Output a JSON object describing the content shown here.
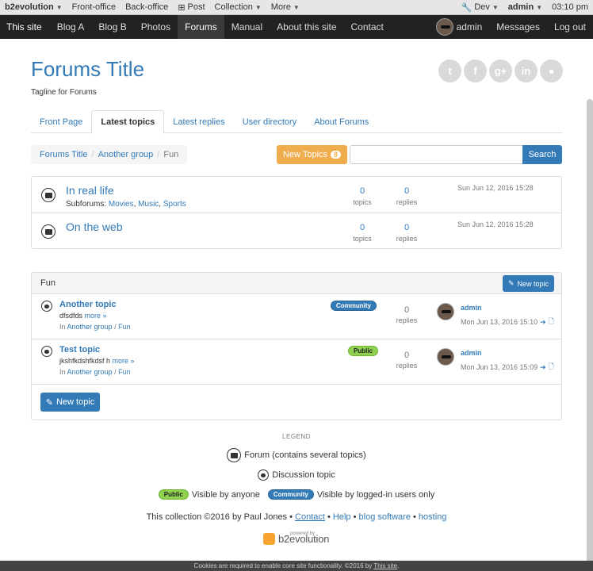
{
  "adminbar": {
    "left_items": [
      {
        "label": "b2evolution",
        "caret": true,
        "bold": true
      },
      {
        "label": "Front-office",
        "caret": false,
        "bold": false
      },
      {
        "label": "Back-office",
        "caret": false,
        "bold": false
      },
      {
        "label": "Post",
        "caret": false,
        "bold": false
      },
      {
        "label": "Collection",
        "caret": true,
        "bold": false
      },
      {
        "label": "More",
        "caret": true,
        "bold": false
      }
    ],
    "dev_label": "Dev",
    "user_label": "admin",
    "time": "03:10 pm"
  },
  "navbar": {
    "brand": "This site",
    "items": [
      "Blog A",
      "Blog B",
      "Photos",
      "Forums",
      "Manual",
      "About this site",
      "Contact"
    ],
    "active": "Forums",
    "user": "admin",
    "messages": "Messages",
    "logout": "Log out"
  },
  "page": {
    "title": "Forums Title",
    "tagline": "Tagline for Forums",
    "social_icons": [
      "twitter-icon",
      "facebook-icon",
      "googleplus-icon",
      "linkedin-icon",
      "github-icon"
    ]
  },
  "tabs": [
    "Front Page",
    "Latest topics",
    "Latest replies",
    "User directory",
    "About Forums"
  ],
  "active_tab": "Latest topics",
  "breadcrumb": {
    "items": [
      "Forums Title",
      "Another group"
    ],
    "current": "Fun"
  },
  "toolbar": {
    "new_topics_label": "New Topics",
    "new_topics_count": "8",
    "search_placeholder": "",
    "search_label": "Search"
  },
  "forums": [
    {
      "name": "In real life",
      "subforums_label": "Subforums:",
      "subforums": [
        "Movies",
        "Music",
        "Sports"
      ],
      "topics": "0",
      "topics_label": "topics",
      "replies": "0",
      "replies_label": "replies",
      "date": "Sun Jun 12, 2016 15:28"
    },
    {
      "name": "On the web",
      "subforums_label": "",
      "subforums": [],
      "topics": "0",
      "topics_label": "topics",
      "replies": "0",
      "replies_label": "replies",
      "date": "Sun Jun 12, 2016 15:28"
    }
  ],
  "topics_panel": {
    "title": "Fun",
    "new_topic_label": "New topic",
    "topics": [
      {
        "title": "Another topic",
        "excerpt": "dfsdfds",
        "more": "more »",
        "in_label": "In",
        "group": "Another group",
        "forum": "Fun",
        "badge": "Community",
        "badge_type": "comm",
        "replies": "0",
        "replies_label": "replies",
        "user": "admin",
        "date": "Mon Jun 13, 2016 15:10"
      },
      {
        "title": "Test topic",
        "excerpt": "jkshfkdshfkdsf h",
        "more": "more »",
        "in_label": "In",
        "group": "Another group",
        "forum": "Fun",
        "badge": "Public",
        "badge_type": "pub",
        "replies": "0",
        "replies_label": "replies",
        "user": "admin",
        "date": "Mon Jun 13, 2016 15:09"
      }
    ]
  },
  "legend": {
    "heading": "LEGEND",
    "forum": "Forum (contains several topics)",
    "discussion": "Discussion topic",
    "public_badge": "Public",
    "public_text": "Visible by anyone",
    "community_badge": "Community",
    "community_text": "Visible by logged-in users only"
  },
  "footer": {
    "text": "This collection ©2016 by Paul Jones •",
    "links": [
      "Contact",
      "Help",
      "blog software",
      "hosting"
    ],
    "powered_small": "powered by",
    "powered_word": "b2evolution"
  },
  "cookie": {
    "text": "Cookies are required to enable core site functionality. ©2016 by",
    "link": "This site"
  },
  "colors": {
    "accent": "#337ab7",
    "warning": "#f0ad4e",
    "community": "#337ab7",
    "public": "#8fd14f",
    "navbar": "#222222"
  }
}
